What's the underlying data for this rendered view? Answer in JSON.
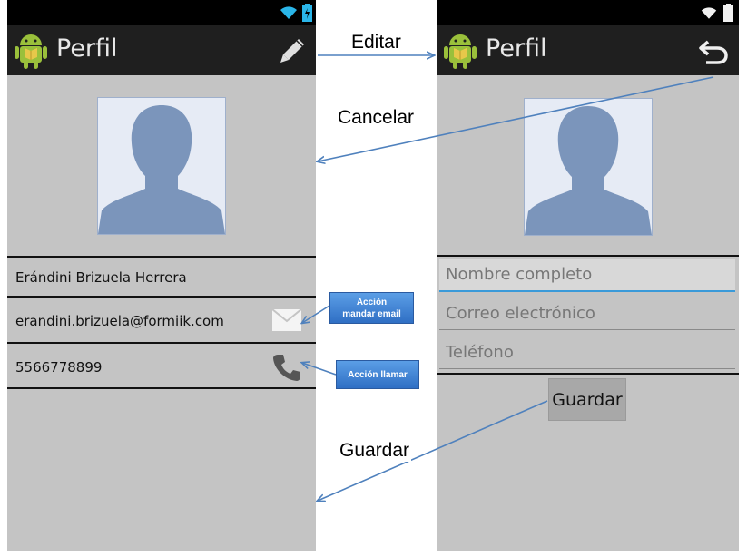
{
  "left_screen": {
    "title": "Perfil",
    "name": "Erándini Brizuela Herrera",
    "email": "erandini.brizuela@formiik.com",
    "phone": "5566778899"
  },
  "right_screen": {
    "title": "Perfil",
    "fields": {
      "name_placeholder": "Nombre completo",
      "email_placeholder": "Correo electrónico",
      "phone_placeholder": "Teléfono"
    },
    "save_button": "Guardar"
  },
  "annotations": {
    "edit": "Editar",
    "cancel": "Cancelar",
    "save": "Guardar",
    "email_action_line1": "Acción",
    "email_action_line2": "mandar email",
    "call_action": "Acción llamar"
  },
  "icons": [
    "android-icon",
    "pencil-icon",
    "undo-icon",
    "wifi-icon",
    "battery-icon",
    "mail-icon",
    "phone-icon",
    "avatar-silhouette"
  ],
  "colors": {
    "accent": "#3a9ad9",
    "arrow": "#4f81bd",
    "callout": "#3b7bd1"
  }
}
